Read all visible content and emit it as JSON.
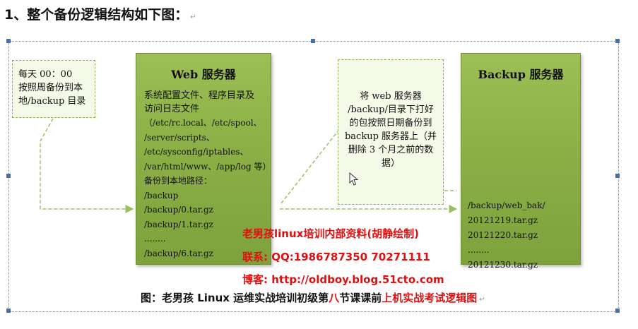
{
  "heading": "1、整个备份逻辑结构如下图：",
  "schedule_note": [
    "每天 00：00",
    "按照周备份到本",
    "地/backup 目录"
  ],
  "web_server": {
    "title": "Web 服务器",
    "description": [
      "系统配置文件、程序目录及",
      "访问日志文件"
    ],
    "paths": [
      "（/etc/rc.local、/etc/spool、",
      "/server/scripts、",
      "/etc/sysconfig/iptables、",
      "/var/html/www、/app/log 等）",
      "备份到本地路径：",
      "/backup",
      "/backup/0.tar.gz",
      "/backup/1.tar.gz",
      "........",
      "/backup/6.tar.gz"
    ]
  },
  "transfer_note": [
    "将 web 服务器",
    "/backup/目录下打好",
    "的包按照日期备份到",
    "backup 服务器上（并",
    "删除 3 个月之前的数",
    "据）"
  ],
  "backup_server": {
    "title": "Backup 服务器",
    "files": [
      "/backup/web_bak/",
      "20121219.tar.gz",
      "20121220.tar.gz",
      "........",
      "20121230.tar.gz"
    ]
  },
  "watermark": {
    "line1": "老男孩linux培训内部资料(胡静绘制)",
    "line2": "联系: QQ:1986787350 70271111",
    "line3": "博客: http://oldboy.blog.51cto.com"
  },
  "caption": {
    "prefix": "图：老男孩 Linux 运维实战培训初级第",
    "highlight1": "八",
    "middle": "节课课前",
    "highlight2": "上机实战考试逻辑图"
  },
  "colors": {
    "server_green": "#8cb046",
    "note_border": "#8fb15a",
    "watermark_red": "#e01010"
  }
}
